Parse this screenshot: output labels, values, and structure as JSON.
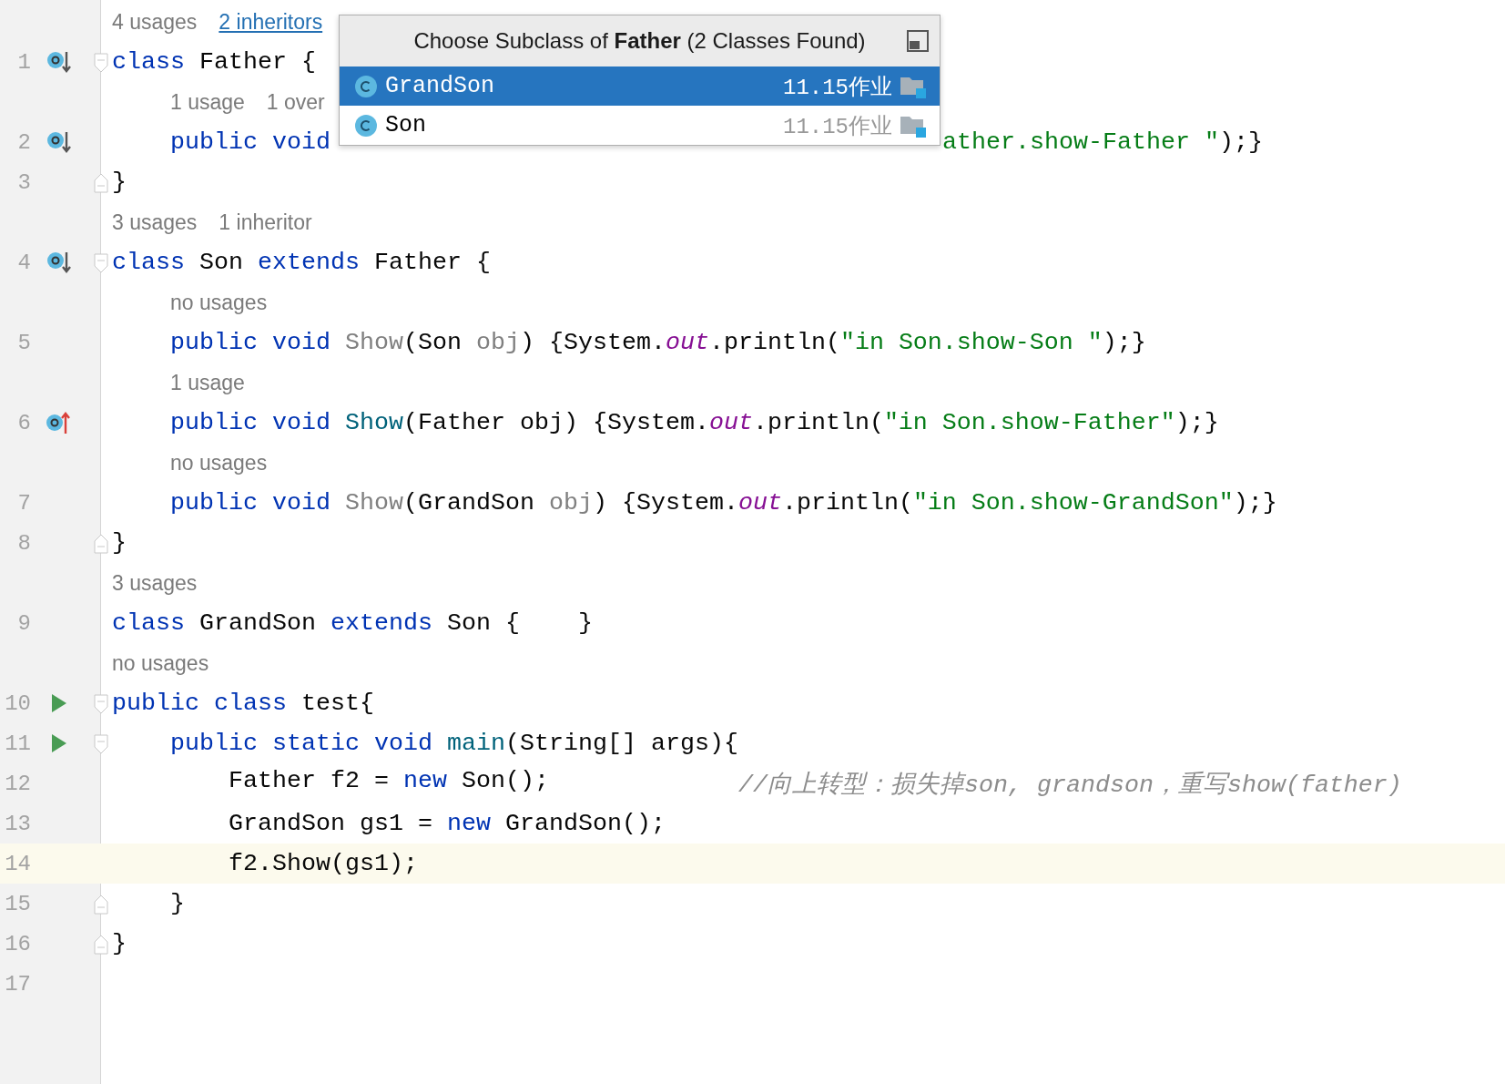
{
  "lines": [
    {
      "number": "1",
      "current": false,
      "hint": [
        {
          "text": "4 usages",
          "link": false
        },
        {
          "text": "2 inheritors",
          "link": true
        }
      ],
      "marker": {
        "kind": "implemented"
      },
      "fold": {
        "kind": "start"
      },
      "tokens": [
        {
          "text": "class ",
          "kind": "keyword"
        },
        {
          "text": "Father {",
          "kind": "plain"
        }
      ],
      "children": [
        {
          "number": "2",
          "current": false,
          "hint": [
            {
              "text": "1 usage",
              "link": false
            },
            {
              "text": "1 over",
              "link": false
            }
          ],
          "marker": {
            "kind": "implemented"
          },
          "tokens": [
            {
              "text": "public void",
              "kind": "keyword"
            }
          ],
          "tokens_after_popup": [
            {
              "text": "ather.show-Father \"",
              "kind": "string"
            },
            {
              "text": ");}",
              "kind": "plain"
            }
          ]
        }
      ]
    },
    {
      "number": "3",
      "current": false,
      "fold": {
        "kind": "end"
      },
      "tokens": [
        {
          "text": "}",
          "kind": "plain"
        }
      ]
    },
    {
      "number": "4",
      "current": false,
      "hint": [
        {
          "text": "3 usages",
          "link": false
        },
        {
          "text": "1 inheritor",
          "link": false
        }
      ],
      "marker": {
        "kind": "implemented"
      },
      "fold": {
        "kind": "start"
      },
      "tokens": [
        {
          "text": "class ",
          "kind": "keyword"
        },
        {
          "text": "Son ",
          "kind": "plain"
        },
        {
          "text": "extends ",
          "kind": "keyword"
        },
        {
          "text": "Father {",
          "kind": "plain"
        }
      ],
      "children": [
        {
          "number": "5",
          "current": false,
          "hint": [
            {
              "text": "no usages",
              "link": false
            }
          ],
          "tokens": [
            {
              "text": "public void ",
              "kind": "keyword"
            },
            {
              "text": "Show",
              "kind": "unused"
            },
            {
              "text": "(Son ",
              "kind": "plain"
            },
            {
              "text": "obj",
              "kind": "unused"
            },
            {
              "text": ") {System.",
              "kind": "plain"
            },
            {
              "text": "out",
              "kind": "field"
            },
            {
              "text": ".println(",
              "kind": "plain"
            },
            {
              "text": "\"in Son.show-Son \"",
              "kind": "string"
            },
            {
              "text": ");}",
              "kind": "plain"
            }
          ]
        },
        {
          "number": "6",
          "current": false,
          "hint": [
            {
              "text": "1 usage",
              "link": false
            }
          ],
          "marker": {
            "kind": "overrides"
          },
          "tokens": [
            {
              "text": "public void ",
              "kind": "keyword"
            },
            {
              "text": "Show",
              "kind": "method"
            },
            {
              "text": "(Father obj) {System.",
              "kind": "plain"
            },
            {
              "text": "out",
              "kind": "field"
            },
            {
              "text": ".println(",
              "kind": "plain"
            },
            {
              "text": "\"in Son.show-Father\"",
              "kind": "string"
            },
            {
              "text": ");}",
              "kind": "plain"
            }
          ]
        },
        {
          "number": "7",
          "current": false,
          "hint": [
            {
              "text": "no usages",
              "link": false
            }
          ],
          "tokens": [
            {
              "text": "public void ",
              "kind": "keyword"
            },
            {
              "text": "Show",
              "kind": "unused"
            },
            {
              "text": "(GrandSon ",
              "kind": "plain"
            },
            {
              "text": "obj",
              "kind": "unused"
            },
            {
              "text": ") {System.",
              "kind": "plain"
            },
            {
              "text": "out",
              "kind": "field"
            },
            {
              "text": ".println(",
              "kind": "plain"
            },
            {
              "text": "\"in Son.show-GrandSon\"",
              "kind": "string"
            },
            {
              "text": ");}",
              "kind": "plain"
            }
          ]
        }
      ]
    },
    {
      "number": "8",
      "current": false,
      "fold": {
        "kind": "end"
      },
      "tokens": [
        {
          "text": "}",
          "kind": "plain"
        }
      ]
    },
    {
      "number": "9",
      "current": false,
      "hint": [
        {
          "text": "3 usages",
          "link": false
        }
      ],
      "tokens": [
        {
          "text": "class ",
          "kind": "keyword"
        },
        {
          "text": "GrandSon ",
          "kind": "plain"
        },
        {
          "text": "extends ",
          "kind": "keyword"
        },
        {
          "text": "Son {    }",
          "kind": "plain"
        }
      ]
    },
    {
      "number": "10",
      "current": false,
      "hint": [
        {
          "text": "no usages",
          "link": false
        }
      ],
      "marker": {
        "kind": "run"
      },
      "fold": {
        "kind": "start"
      },
      "tokens": [
        {
          "text": "public class ",
          "kind": "keyword"
        },
        {
          "text": "test{",
          "kind": "plain"
        }
      ],
      "children": [
        {
          "number": "11",
          "current": false,
          "marker": {
            "kind": "run"
          },
          "fold": {
            "kind": "start"
          },
          "tokens": [
            {
              "text": "public static void ",
              "kind": "keyword"
            },
            {
              "text": "main",
              "kind": "method"
            },
            {
              "text": "(String[] args){",
              "kind": "plain"
            }
          ],
          "children": [
            {
              "number": "12",
              "current": false,
              "tokens": [
                {
                  "text": "Father f2 = ",
                  "kind": "plain"
                },
                {
                  "text": "new ",
                  "kind": "keyword"
                },
                {
                  "text": "Son();",
                  "kind": "plain"
                },
                {
                  "text": "//向上转型：损失掉son, grandson，重写show(father)",
                  "kind": "comment"
                }
              ]
            },
            {
              "number": "13",
              "current": false,
              "tokens": [
                {
                  "text": "GrandSon gs1 = ",
                  "kind": "plain"
                },
                {
                  "text": "new ",
                  "kind": "keyword"
                },
                {
                  "text": "GrandSon();",
                  "kind": "plain"
                }
              ]
            },
            {
              "number": "14",
              "current": true,
              "tokens": [
                {
                  "text": "f2.Show(gs1);",
                  "kind": "plain"
                }
              ]
            }
          ]
        },
        {
          "number": "15",
          "current": false,
          "fold": {
            "kind": "end"
          },
          "tokens": [
            {
              "text": "}",
              "kind": "plain"
            }
          ]
        }
      ]
    },
    {
      "number": "16",
      "current": false,
      "fold": {
        "kind": "end"
      },
      "tokens": [
        {
          "text": "}",
          "kind": "plain"
        }
      ]
    },
    {
      "number": "17",
      "current": false
    }
  ],
  "popup": {
    "title": "Choose Subclass of **Father** (2 Classes Found)",
    "items": [
      {
        "name": "GrandSon",
        "location": "11.15作业",
        "selected": true
      },
      {
        "name": "Son",
        "location": "11.15作业",
        "selected": false
      }
    ]
  }
}
